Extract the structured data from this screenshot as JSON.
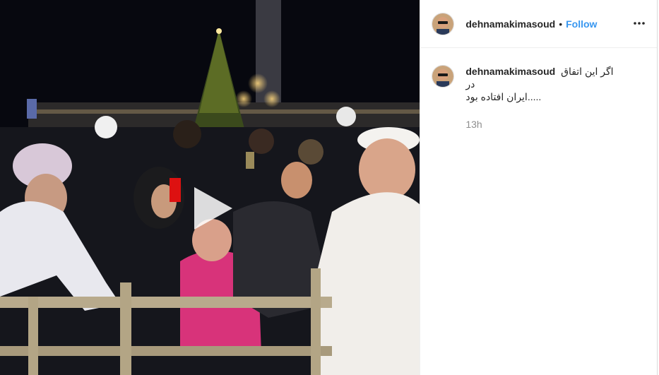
{
  "post": {
    "media": {
      "type": "video",
      "play_icon": "play-icon"
    },
    "header": {
      "username": "dehnamakimasoud",
      "separator": "•",
      "follow_label": "Follow",
      "more_icon": "more-horizontal-icon"
    },
    "caption": {
      "username": "dehnamakimasoud",
      "line1": "اگر این اتفاق در",
      "line2": "ایران افتاده بود....."
    },
    "timestamp": "13h"
  }
}
